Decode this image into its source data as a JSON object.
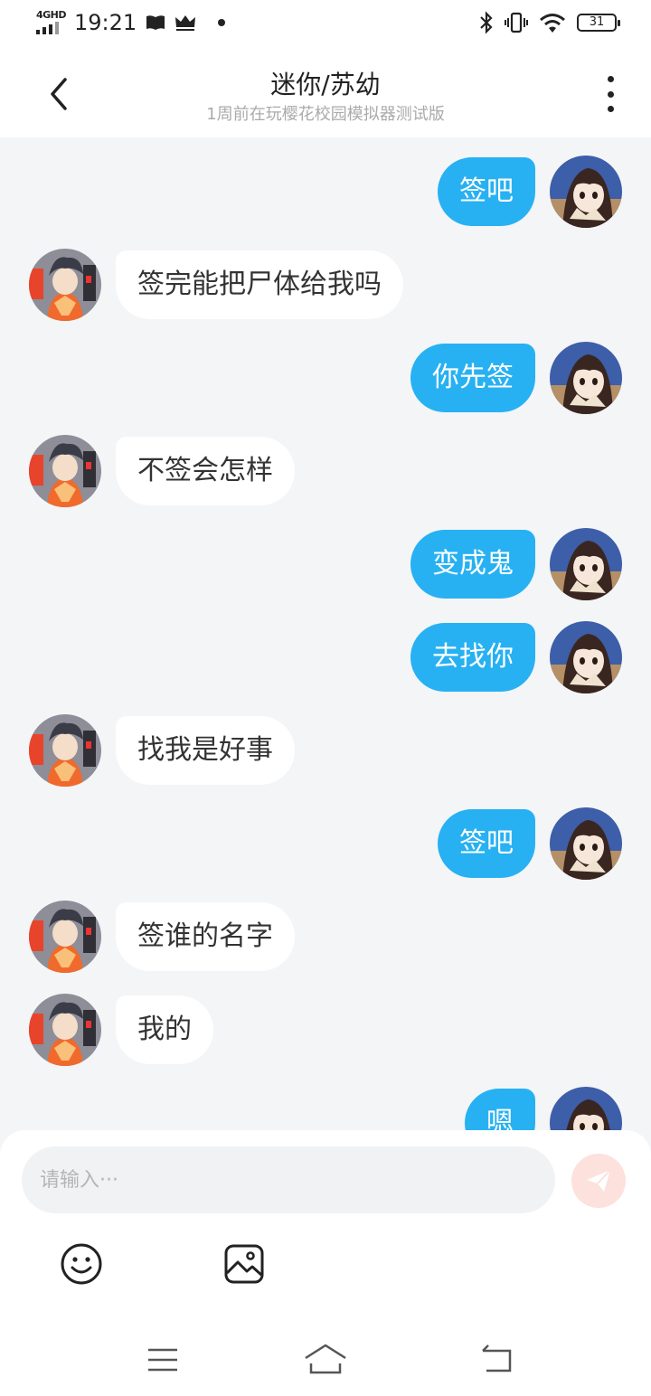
{
  "status_bar": {
    "network": "4GHD",
    "time": "19:21",
    "battery": "31"
  },
  "header": {
    "title": "迷你/苏幼",
    "subtitle": "1周前在玩樱花校园模拟器测试版"
  },
  "messages": [
    {
      "from": "me",
      "text": "签吧"
    },
    {
      "from": "other",
      "text": "签完能把尸体给我吗"
    },
    {
      "from": "me",
      "text": "你先签"
    },
    {
      "from": "other",
      "text": "不签会怎样"
    },
    {
      "from": "me",
      "text": "变成鬼"
    },
    {
      "from": "me",
      "text": "去找你"
    },
    {
      "from": "other",
      "text": "找我是好事"
    },
    {
      "from": "me",
      "text": "签吧"
    },
    {
      "from": "other",
      "text": "签谁的名字"
    },
    {
      "from": "other",
      "text": "我的"
    },
    {
      "from": "me",
      "text": "嗯"
    }
  ],
  "input": {
    "placeholder": "请输入···",
    "value": ""
  },
  "colors": {
    "my_bubble": "#27b1f2",
    "other_bubble": "#ffffff",
    "background": "#f3f5f7",
    "send_button": "#fde1dc"
  },
  "icons": [
    "back-arrow-icon",
    "more-icon",
    "emoji-icon",
    "image-icon",
    "send-icon",
    "menu-icon",
    "home-icon",
    "return-icon"
  ]
}
